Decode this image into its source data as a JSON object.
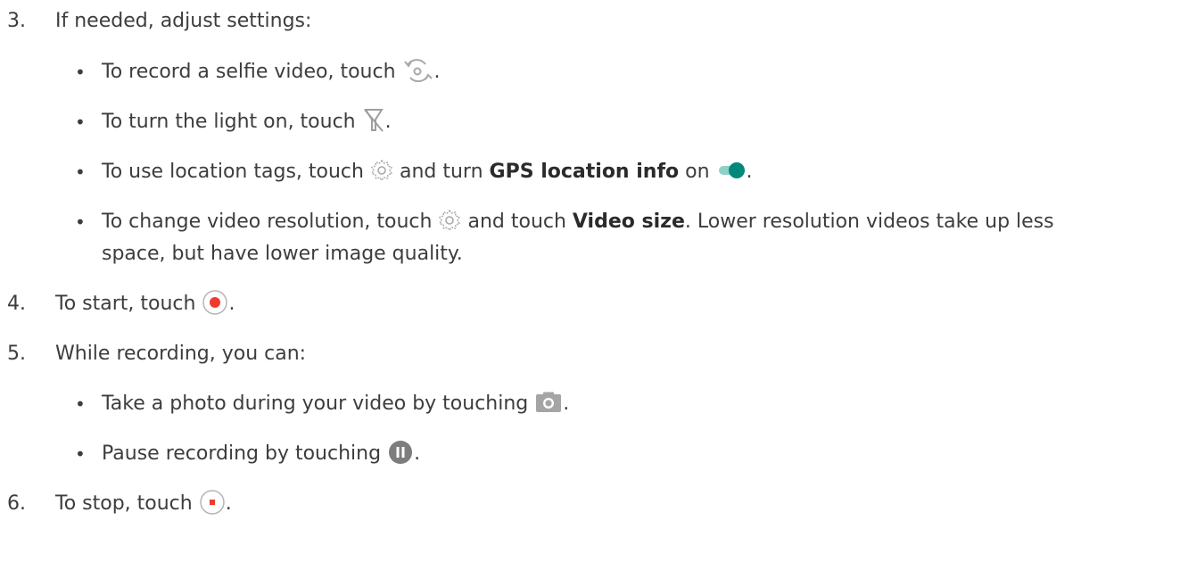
{
  "steps": [
    {
      "number": "3.",
      "text": "If needed, adjust settings:",
      "bullets": [
        {
          "bullet": "•",
          "prefix": "To record a selfie video, touch",
          "icon": "switch-camera-icon",
          "suffix": "."
        },
        {
          "bullet": "•",
          "prefix": "To turn the light on, touch",
          "icon": "flash-off-icon",
          "suffix": "."
        },
        {
          "bullet": "•",
          "prefix": "To use location tags, touch",
          "icon": "settings-gear-icon",
          "middle": "and turn",
          "bold": "GPS location info",
          "after_bold": "on",
          "icon2": "toggle-on-icon",
          "suffix": "."
        },
        {
          "bullet": "•",
          "prefix": "To change video resolution, touch",
          "icon": "settings-gear-icon",
          "middle": "and touch",
          "bold": "Video size",
          "after_bold": ". Lower resolution videos take up less",
          "line2": "space, but have lower image quality."
        }
      ]
    },
    {
      "number": "4.",
      "prefix": "To start, touch",
      "icon": "record-start-icon",
      "suffix": "."
    },
    {
      "number": "5.",
      "text": "While recording, you can:",
      "bullets": [
        {
          "bullet": "•",
          "prefix": "Take a photo during your video by touching",
          "icon": "camera-capture-icon",
          "suffix": "."
        },
        {
          "bullet": "•",
          "prefix": "Pause recording by touching",
          "icon": "pause-icon",
          "suffix": "."
        }
      ]
    },
    {
      "number": "6.",
      "prefix": "To stop, touch",
      "icon": "record-stop-icon",
      "suffix": "."
    }
  ],
  "colors": {
    "text": "#3d3d3d",
    "icon_gray": "#9e9e9e",
    "toggle_on": "#00897b",
    "toggle_track": "#8ed1c8",
    "record_red": "#ef3b2d"
  }
}
